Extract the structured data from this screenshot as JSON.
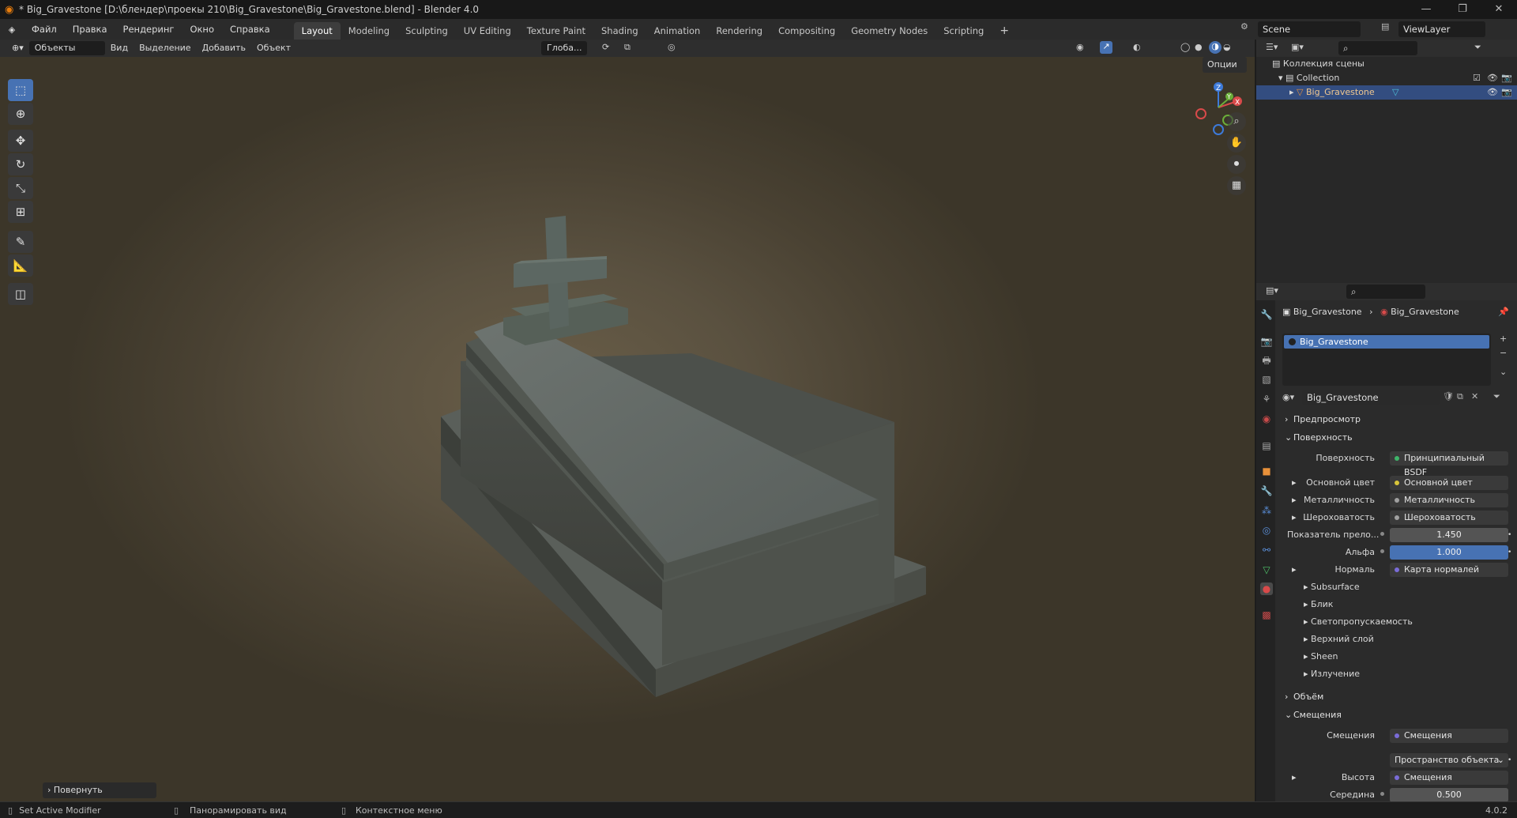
{
  "window": {
    "title": "* Big_Gravestone [D:\\блендер\\проекы 210\\Big_Gravestone\\Big_Gravestone.blend] - Blender 4.0"
  },
  "menus": [
    "Файл",
    "Правка",
    "Рендеринг",
    "Окно",
    "Справка"
  ],
  "workspaces": [
    "Layout",
    "Modeling",
    "Sculpting",
    "UV Editing",
    "Texture Paint",
    "Shading",
    "Animation",
    "Rendering",
    "Compositing",
    "Geometry Nodes",
    "Scripting"
  ],
  "active_workspace": "Layout",
  "scene": {
    "label": "Scene",
    "viewlayer": "ViewLayer"
  },
  "viewport_header": {
    "mode": "Объекты",
    "items": [
      "Вид",
      "Выделение",
      "Добавить",
      "Объект"
    ],
    "transform": "Глоба...",
    "options": "Опции"
  },
  "last_operator": "Повернуть",
  "outliner": {
    "root": "Коллекция сцены",
    "collection": "Collection",
    "object": "Big_Gravestone"
  },
  "properties": {
    "breadcrumb_obj": "Big_Gravestone",
    "breadcrumb_mat": "Big_Gravestone",
    "slot": "Big_Gravestone",
    "material_name": "Big_Gravestone",
    "sections": {
      "preview": "Предпросмотр",
      "surface": "Поверхность",
      "volume": "Объём",
      "displacement": "Смещения"
    },
    "rows": [
      {
        "label": "Поверхность",
        "value": "Принципиальный BSDF",
        "dot": "#3fb56a"
      },
      {
        "label": "Основной цвет",
        "value": "Основной цвет",
        "dot": "#d8c53a",
        "expand": true
      },
      {
        "label": "Металличность",
        "value": "Металличность",
        "dot": "#a0a0a0",
        "expand": true
      },
      {
        "label": "Шероховатость",
        "value": "Шероховатость",
        "dot": "#a0a0a0",
        "expand": true
      }
    ],
    "ior": {
      "label": "Показатель прело...",
      "value": "1.450"
    },
    "alpha": {
      "label": "Альфа",
      "value": "1.000"
    },
    "normal": {
      "label": "Нормаль",
      "value": "Карта нормалей",
      "dot": "#7a6cd8"
    },
    "subpanels": [
      "Subsurface",
      "Блик",
      "Светопропускаемость",
      "Верхний слой",
      "Sheen",
      "Излучение"
    ],
    "disp": {
      "label": "Смещения",
      "value": "Смещения",
      "space": "Пространство объекта",
      "height_label": "Высота",
      "height_value": "Смещения",
      "mid_label": "Середина",
      "mid_value": "0.500"
    }
  },
  "statusbar": {
    "left": "Set Active Modifier",
    "mid": "Панорамировать вид",
    "right": "Контекстное меню",
    "version": "4.0.2"
  },
  "colors": {
    "accent": "#4772b3",
    "bg": "#2b2b2b"
  }
}
